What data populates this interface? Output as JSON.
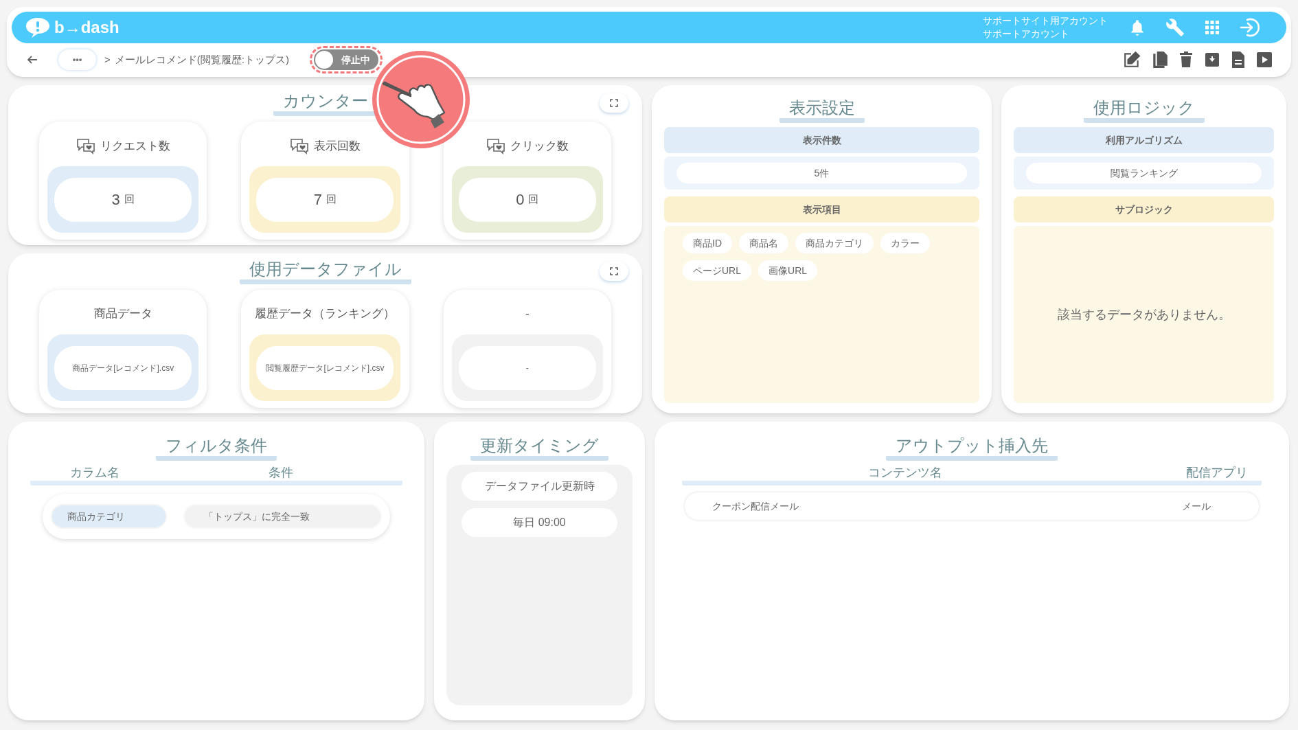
{
  "header": {
    "logo": "b→dash",
    "account_lines": [
      "サポートサイト用アカウント",
      "サポートアカウント"
    ]
  },
  "breadcrumb": {
    "more": "•••",
    "separator": ">",
    "title": "メールレコメンド(閲覧履歴:トップス)"
  },
  "toggle": {
    "label": "停止中",
    "on": false
  },
  "counter": {
    "title": "カウンター",
    "cards": [
      {
        "label": "リクエスト数",
        "value": "3",
        "unit": "回",
        "color": "#e0edf8"
      },
      {
        "label": "表示回数",
        "value": "7",
        "unit": "回",
        "color": "#fcf1cf"
      },
      {
        "label": "クリック数",
        "value": "0",
        "unit": "回",
        "color": "#e9eed8"
      }
    ]
  },
  "data_files": {
    "title": "使用データファイル",
    "cards": [
      {
        "label": "商品データ",
        "file": "商品データ[レコメンド].csv",
        "color": "#e0edf8"
      },
      {
        "label": "履歴データ（ランキング）",
        "file": "閲覧履歴データ[レコメンド].csv",
        "color": "#fcf1cf"
      },
      {
        "label": "-",
        "file": "-",
        "color": "#f2f2f2"
      }
    ]
  },
  "display_settings": {
    "title": "表示設定",
    "count_label": "表示件数",
    "count_value": "5件",
    "items_label": "表示項目",
    "items": [
      "商品ID",
      "商品名",
      "商品カテゴリ",
      "カラー",
      "ページURL",
      "画像URL"
    ]
  },
  "logic": {
    "title": "使用ロジック",
    "algorithm_label": "利用アルゴリズム",
    "algorithm": "閲覧ランキング",
    "sub_label": "サブロジック",
    "sub_empty": "該当するデータがありません。"
  },
  "filter": {
    "title": "フィルタ条件",
    "columns": [
      "カラム名",
      "条件"
    ],
    "rows": [
      {
        "column": "商品カテゴリ",
        "condition": "「トップス」に完全一致"
      }
    ]
  },
  "timing": {
    "title": "更新タイミング",
    "items": [
      "データファイル更新時",
      "毎日 09:00"
    ]
  },
  "output": {
    "title": "アウトプット挿入先",
    "columns": [
      "コンテンツ名",
      "配信アプリ"
    ],
    "rows": [
      {
        "content": "クーポン配信メール",
        "app": "メール"
      }
    ]
  }
}
